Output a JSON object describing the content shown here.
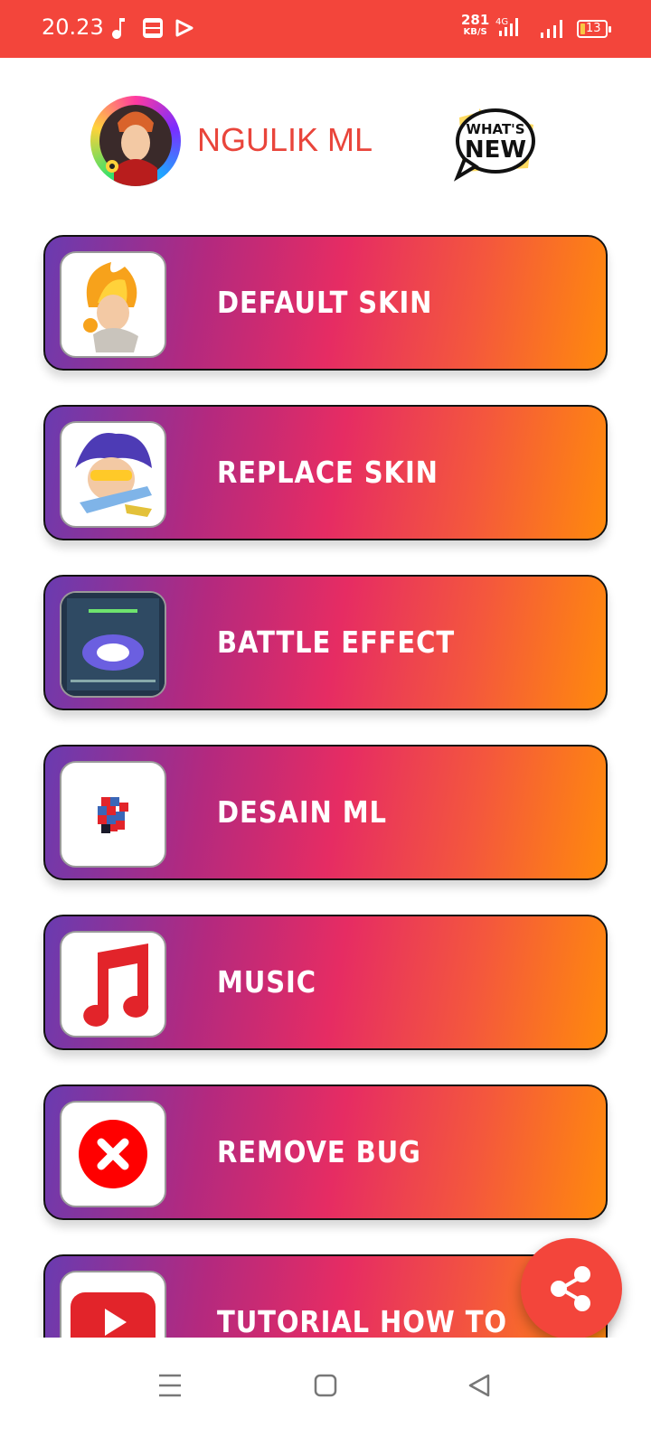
{
  "status_bar": {
    "time": "20.23",
    "net_speed": "281",
    "net_speed_unit": "KB/S",
    "network_type": "4G",
    "battery_level": "13",
    "notification_icons": [
      "music-note-icon",
      "brimo-app-icon",
      "play-store-icon"
    ]
  },
  "header": {
    "title": "NGULIK ML",
    "whats_new": {
      "line1": "WHAT'S",
      "line2": "NEW"
    }
  },
  "menu": {
    "items": [
      {
        "label": "DEFAULT SKIN",
        "icon": "hero-fire-thumbnail"
      },
      {
        "label": "REPLACE SKIN",
        "icon": "hero-blue-hair-thumbnail"
      },
      {
        "label": "BATTLE EFFECT",
        "icon": "battle-effect-screenshot"
      },
      {
        "label": "DESAIN ML",
        "icon": "pixel-cube-icon"
      },
      {
        "label": "MUSIC",
        "icon": "music-note-icon"
      },
      {
        "label": "REMOVE BUG",
        "icon": "close-circle-icon"
      },
      {
        "label": "TUTORIAL HOW TO USE",
        "icon": "youtube-icon"
      }
    ]
  },
  "fab": {
    "icon": "share-icon"
  },
  "nav_bar": {
    "buttons": [
      "menu-icon",
      "home-square-icon",
      "back-triangle-icon"
    ]
  },
  "colors": {
    "accent": "#f3453b",
    "gradient": [
      "#6a3bb0",
      "#e62c63",
      "#ff8a0c"
    ],
    "title_color": "#e9453b"
  }
}
